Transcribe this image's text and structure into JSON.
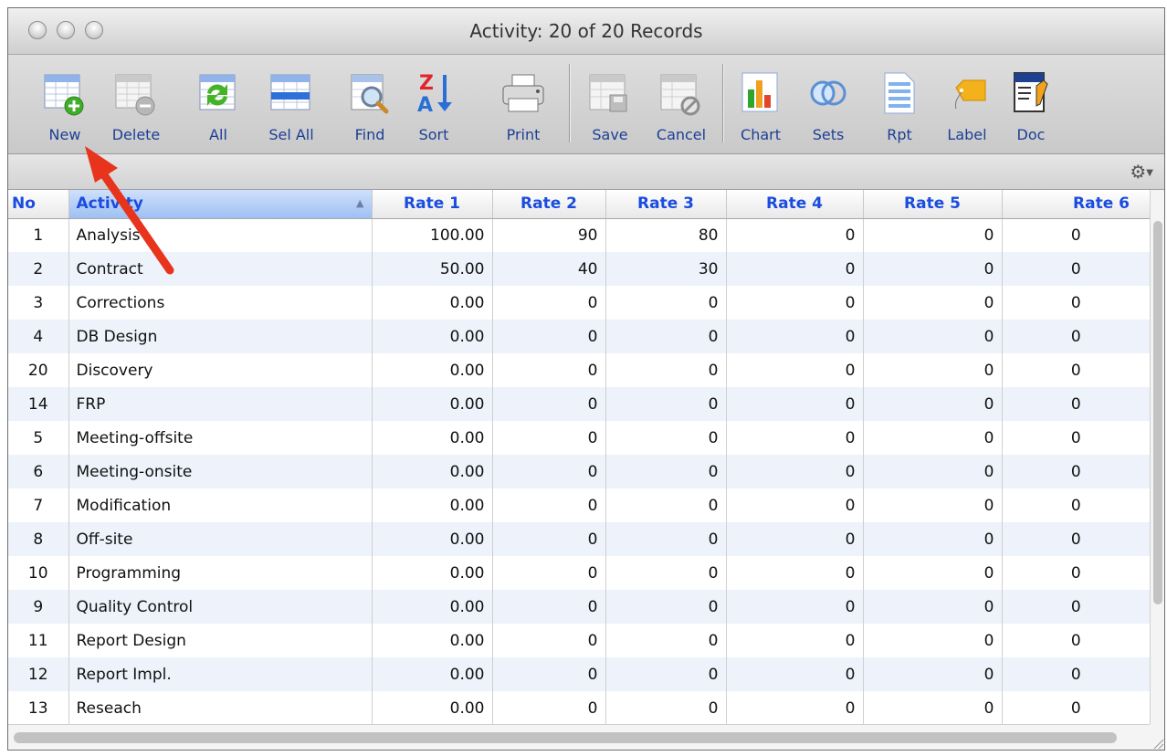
{
  "window": {
    "title": "Activity: 20 of 20 Records"
  },
  "toolbar": {
    "buttons": [
      {
        "label": "New",
        "icon": "new-record-icon"
      },
      {
        "label": "Delete",
        "icon": "delete-record-icon"
      },
      {
        "label": "All",
        "icon": "show-all-icon"
      },
      {
        "label": "Sel All",
        "icon": "select-all-icon"
      },
      {
        "label": "Find",
        "icon": "find-icon"
      },
      {
        "label": "Sort",
        "icon": "sort-icon"
      },
      {
        "label": "Print",
        "icon": "printer-icon"
      },
      {
        "label": "Save",
        "icon": "save-icon"
      },
      {
        "label": "Cancel",
        "icon": "cancel-icon"
      },
      {
        "label": "Chart",
        "icon": "chart-icon"
      },
      {
        "label": "Sets",
        "icon": "sets-icon"
      },
      {
        "label": "Rpt",
        "icon": "report-icon"
      },
      {
        "label": "Label",
        "icon": "label-tag-icon"
      },
      {
        "label": "Doc",
        "icon": "document-icon"
      }
    ]
  },
  "table": {
    "columns": [
      "No",
      "Activity",
      "Rate 1",
      "Rate 2",
      "Rate 3",
      "Rate 4",
      "Rate 5",
      "Rate 6"
    ],
    "sort_column": "Activity",
    "sort_direction": "ascending",
    "rows": [
      {
        "no": "1",
        "activity": "Analysis",
        "rate1": "100.00",
        "rate2": "90",
        "rate3": "80",
        "rate4": "0",
        "rate5": "0",
        "rate6": "0"
      },
      {
        "no": "2",
        "activity": "Contract",
        "rate1": "50.00",
        "rate2": "40",
        "rate3": "30",
        "rate4": "0",
        "rate5": "0",
        "rate6": "0"
      },
      {
        "no": "3",
        "activity": "Corrections",
        "rate1": "0.00",
        "rate2": "0",
        "rate3": "0",
        "rate4": "0",
        "rate5": "0",
        "rate6": "0"
      },
      {
        "no": "4",
        "activity": "DB Design",
        "rate1": "0.00",
        "rate2": "0",
        "rate3": "0",
        "rate4": "0",
        "rate5": "0",
        "rate6": "0"
      },
      {
        "no": "20",
        "activity": "Discovery",
        "rate1": "0.00",
        "rate2": "0",
        "rate3": "0",
        "rate4": "0",
        "rate5": "0",
        "rate6": "0"
      },
      {
        "no": "14",
        "activity": "FRP",
        "rate1": "0.00",
        "rate2": "0",
        "rate3": "0",
        "rate4": "0",
        "rate5": "0",
        "rate6": "0"
      },
      {
        "no": "5",
        "activity": "Meeting-offsite",
        "rate1": "0.00",
        "rate2": "0",
        "rate3": "0",
        "rate4": "0",
        "rate5": "0",
        "rate6": "0"
      },
      {
        "no": "6",
        "activity": "Meeting-onsite",
        "rate1": "0.00",
        "rate2": "0",
        "rate3": "0",
        "rate4": "0",
        "rate5": "0",
        "rate6": "0"
      },
      {
        "no": "7",
        "activity": "Modification",
        "rate1": "0.00",
        "rate2": "0",
        "rate3": "0",
        "rate4": "0",
        "rate5": "0",
        "rate6": "0"
      },
      {
        "no": "8",
        "activity": "Off-site",
        "rate1": "0.00",
        "rate2": "0",
        "rate3": "0",
        "rate4": "0",
        "rate5": "0",
        "rate6": "0"
      },
      {
        "no": "10",
        "activity": "Programming",
        "rate1": "0.00",
        "rate2": "0",
        "rate3": "0",
        "rate4": "0",
        "rate5": "0",
        "rate6": "0"
      },
      {
        "no": "9",
        "activity": "Quality Control",
        "rate1": "0.00",
        "rate2": "0",
        "rate3": "0",
        "rate4": "0",
        "rate5": "0",
        "rate6": "0"
      },
      {
        "no": "11",
        "activity": "Report Design",
        "rate1": "0.00",
        "rate2": "0",
        "rate3": "0",
        "rate4": "0",
        "rate5": "0",
        "rate6": "0"
      },
      {
        "no": "12",
        "activity": "Report Impl.",
        "rate1": "0.00",
        "rate2": "0",
        "rate3": "0",
        "rate4": "0",
        "rate5": "0",
        "rate6": "0"
      },
      {
        "no": "13",
        "activity": "Reseach",
        "rate1": "0.00",
        "rate2": "0",
        "rate3": "0",
        "rate4": "0",
        "rate5": "0",
        "rate6": "0"
      }
    ]
  },
  "colors": {
    "header_text": "#1a4ce0",
    "toolbar_label": "#1c3f95",
    "stripe": "#edf2fb",
    "annotation_arrow": "#e8341c"
  }
}
